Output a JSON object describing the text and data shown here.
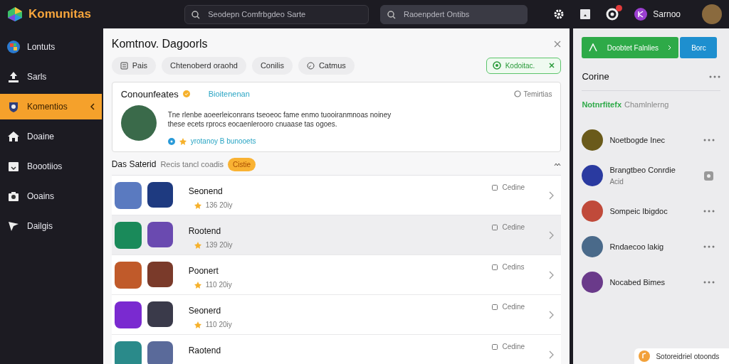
{
  "topbar": {
    "brand": "Komunitas",
    "search_left": {
      "placeholder": "Seodepn Comfrbgdeo Sarte"
    },
    "search_right": {
      "placeholder": "Raoenpdert Ontibs"
    },
    "notification_unread": true,
    "user_name": "Sarnoo"
  },
  "sidebar": {
    "items": [
      {
        "label": "Lontuts",
        "selected": false
      },
      {
        "label": "Sarls",
        "selected": false
      },
      {
        "label": "Komentios",
        "selected": true
      },
      {
        "label": "Doaine",
        "selected": false
      },
      {
        "label": "Boootiios",
        "selected": false
      },
      {
        "label": "Ooains",
        "selected": false
      },
      {
        "label": "Dailgis",
        "selected": false
      }
    ]
  },
  "panel": {
    "title": "Komtnov. Dagoorls",
    "chips": [
      {
        "label": "Pais",
        "kind": "icon"
      },
      {
        "label": "Chtenoberd oraohd",
        "kind": "plain"
      },
      {
        "label": "Conilis",
        "kind": "plain"
      },
      {
        "label": "Catmus",
        "kind": "icon"
      }
    ],
    "status_button": "Kodoitac.",
    "card": {
      "name": "Conounfeates",
      "verified": true,
      "link": "Bioitenenan",
      "action": "Temirtias",
      "description": "Tne rlenbe aoeerleiconrans tseoeoc fame enmo tuooiranmnoas noiney these ecets rprocs eocaenlerooro cnuaase tas ogoes.",
      "footer_link": "yrotanoy B bunooets"
    },
    "section": {
      "title": "Das Saterid",
      "subtitle": "Recis tancl coadis",
      "badge": "Cistie"
    },
    "rows": [
      {
        "title": "Seonend",
        "rating": "136 20iy",
        "status": "Cedine",
        "selected": false
      },
      {
        "title": "Rootend",
        "rating": "139 20iy",
        "status": "Cedine",
        "selected": true
      },
      {
        "title": "Poonert",
        "rating": "110 20iy",
        "status": "Cedins",
        "selected": false
      },
      {
        "title": "Seonerd",
        "rating": "110 20iy",
        "status": "Cedine",
        "selected": false
      },
      {
        "title": "Raotend",
        "status": "Cedine",
        "selected": false
      }
    ]
  },
  "right": {
    "primary_button": "Doobtet Falnlies",
    "secondary_button": "Borc",
    "title": "Corine",
    "tabs": [
      {
        "label": "Notnrfitefx",
        "selected": true
      },
      {
        "label": "Chamlnlerng",
        "selected": false
      }
    ],
    "friends": [
      {
        "name": "Noetbogde Inec",
        "kind": "dots"
      },
      {
        "name": "Brangtbeo Conrdie",
        "detail": "Acid",
        "kind": "badge"
      },
      {
        "name": "Sompeic Ibigdoc",
        "kind": "dots"
      },
      {
        "name": "Rndaecoo lakig",
        "kind": "dots"
      },
      {
        "name": "Nocabed Bimes",
        "kind": "dots"
      }
    ],
    "toast": "Sotoreidriel otoonds"
  }
}
